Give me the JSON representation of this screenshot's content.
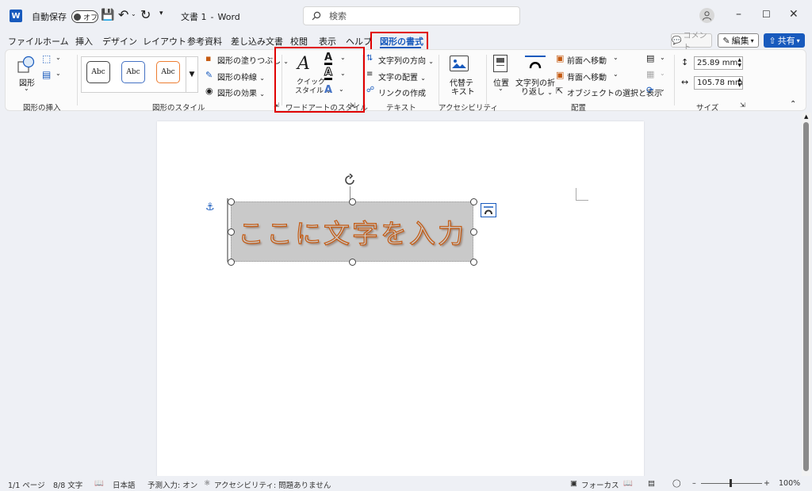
{
  "titlebar": {
    "app_icon": "W",
    "autosave_label": "自動保存",
    "autosave_state": "オフ",
    "doc_title": "文書 1",
    "title_sep": "-",
    "app_name": "Word",
    "search_placeholder": "検索"
  },
  "menu": {
    "tabs": [
      "ファイル",
      "ホーム",
      "挿入",
      "デザイン",
      "レイアウト",
      "参考資料",
      "差し込み文書",
      "校閲",
      "表示",
      "ヘルプ",
      "図形の書式"
    ],
    "active_tab": "図形の書式",
    "comment_label": "コメント",
    "edit_label": "編集",
    "share_label": "共有"
  },
  "ribbon": {
    "insert_shape": {
      "label": "図形の挿入",
      "shapes_label": "図形"
    },
    "shape_styles": {
      "label": "図形のスタイル",
      "styles": [
        "Abc",
        "Abc",
        "Abc"
      ],
      "fill_label": "図形の塗りつぶし",
      "outline_label": "図形の枠線",
      "effects_label": "図形の効果"
    },
    "wordart": {
      "label": "ワードアートのスタイル",
      "quick_style_line1": "クイック",
      "quick_style_line2": "スタイル"
    },
    "text": {
      "label": "テキスト",
      "direction_label": "文字列の方向",
      "align_label": "文字の配置",
      "link_label": "リンクの作成"
    },
    "accessibility": {
      "label": "アクセシビリティ",
      "alt_text_line1": "代替テ",
      "alt_text_line2": "キスト"
    },
    "arrange": {
      "label": "配置",
      "position_label": "位置",
      "wrap_line1": "文字列の折",
      "wrap_line2": "り返し",
      "forward_label": "前面へ移動",
      "backward_label": "背面へ移動",
      "selection_label": "オブジェクトの選択と表示"
    },
    "size": {
      "label": "サイズ",
      "height_value": "25.89 mm",
      "width_value": "105.78 mm"
    }
  },
  "document": {
    "shape_text": "ここに文字を入力"
  },
  "status": {
    "page": "1/1 ページ",
    "words": "8/8 文字",
    "language": "日本語",
    "predictive": "予測入力: オン",
    "accessibility": "アクセシビリティ: 問題ありません",
    "focus": "フォーカス",
    "zoom": "100%"
  },
  "colors": {
    "accent": "#185abd",
    "highlight_box": "#e00000",
    "wordart_outline": "#c55a11",
    "shape_fill": "#c9c9c9"
  }
}
